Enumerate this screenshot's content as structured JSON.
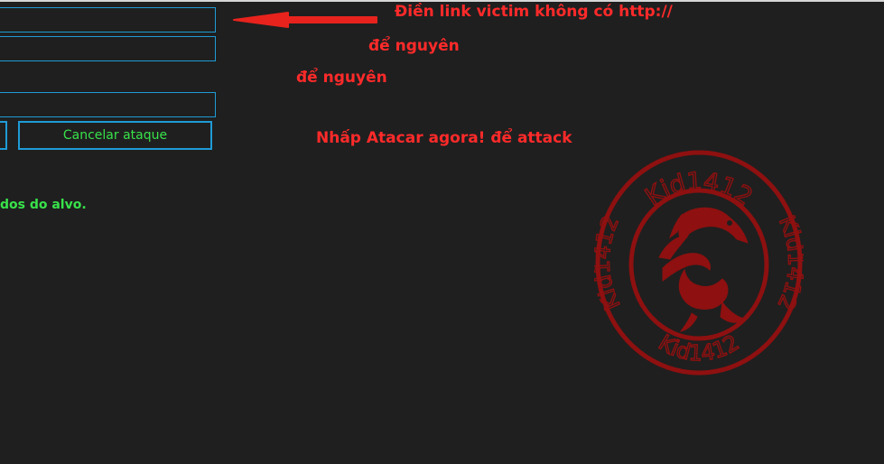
{
  "form": {
    "target_field_value": "",
    "second_field_value": "",
    "third_field_value": "",
    "cancel_button_label": "Cancelar ataque",
    "status_text": "dos do alvo."
  },
  "annotations": {
    "note_link": "Điền link victim không có http://",
    "note_keep_1": "để nguyên",
    "note_keep_2": "để nguyên",
    "note_attack": "Nhấp Atacar agora! để attack"
  },
  "logo": {
    "text_top": "Kid1412",
    "text_left": "Kid1412",
    "text_right": "Kid1412",
    "text_bottom": "Kid1412"
  },
  "colors": {
    "background": "#1f1f1f",
    "field_border": "#1f9bd6",
    "status_green": "#38e24a",
    "annotation_red": "#ff2a2a",
    "logo_red": "#8e1010"
  }
}
